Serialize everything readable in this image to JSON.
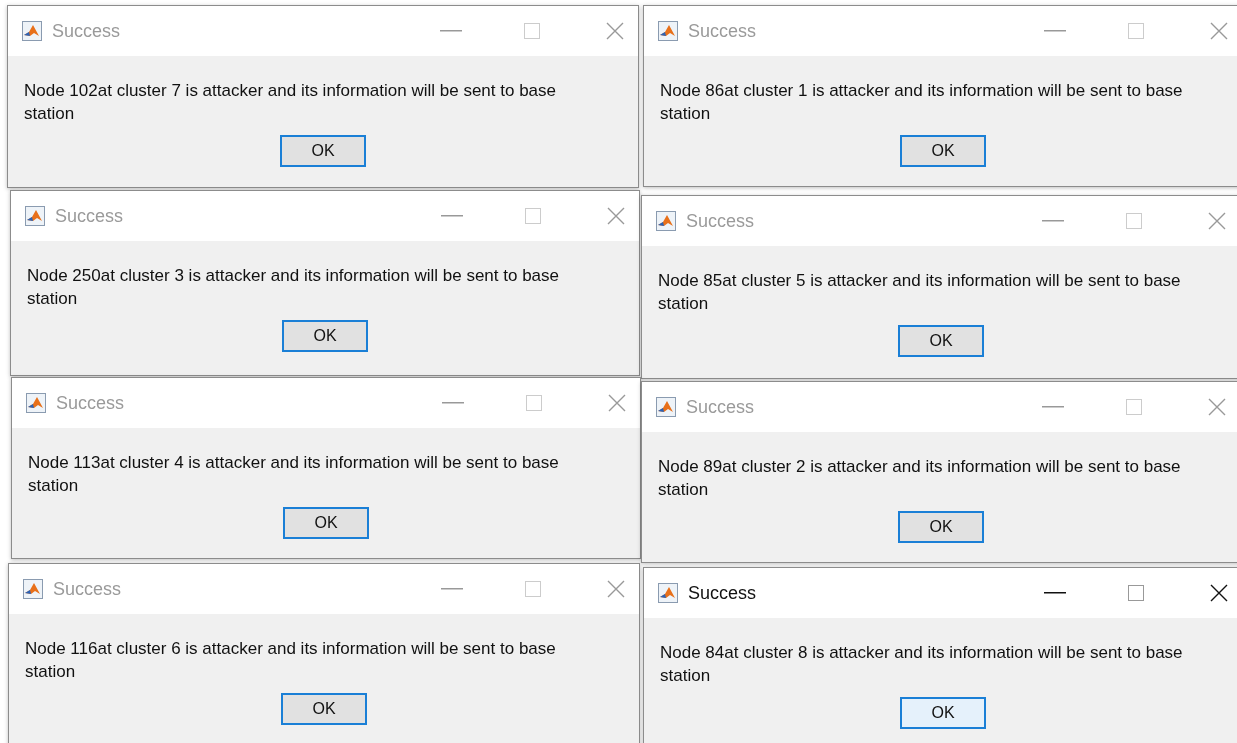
{
  "dialogs": [
    {
      "title": "Success",
      "active": false,
      "message": "Node 102at cluster 7 is attacker and its information will be sent to base station",
      "button": "OK"
    },
    {
      "title": "Success",
      "active": false,
      "message": "Node 86at cluster 1 is attacker and its information will be sent to base station",
      "button": "OK"
    },
    {
      "title": "Success",
      "active": false,
      "message": "Node 250at cluster 3 is attacker and its information will be sent to base station",
      "button": "OK"
    },
    {
      "title": "Success",
      "active": false,
      "message": "Node 85at cluster 5 is attacker and its information will be sent to base station",
      "button": "OK"
    },
    {
      "title": "Success",
      "active": false,
      "message": "Node 113at cluster 4 is attacker and its information will be sent to base station",
      "button": "OK"
    },
    {
      "title": "Success",
      "active": false,
      "message": "Node 89at cluster 2 is attacker and its information will be sent to base station",
      "button": "OK"
    },
    {
      "title": "Success",
      "active": false,
      "message": "Node 116at cluster 6 is attacker and its information will be sent to base station",
      "button": "OK"
    },
    {
      "title": "Success",
      "active": true,
      "message": "Node 84at cluster 8 is attacker and its information will be sent to base station",
      "button": "OK"
    }
  ]
}
